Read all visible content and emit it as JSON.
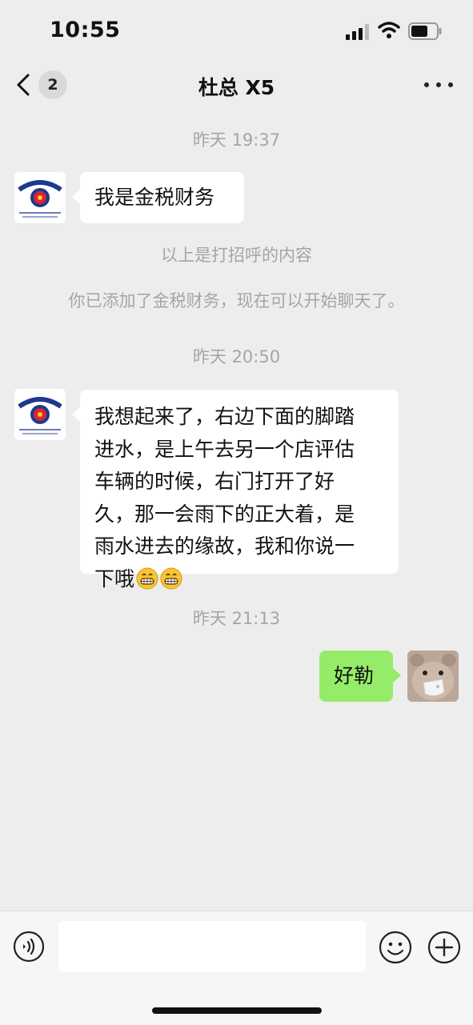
{
  "status": {
    "time": "10:55"
  },
  "header": {
    "back_badge": "2",
    "title": "杜总 X5"
  },
  "messages": [
    {
      "kind": "timestamp",
      "text": "昨天 19:37"
    },
    {
      "kind": "incoming",
      "sender": "金税财务",
      "text": "我是金税财务"
    },
    {
      "kind": "system",
      "text": "以上是打招呼的内容"
    },
    {
      "kind": "system",
      "text": "你已添加了金税财务，现在可以开始聊天了。"
    },
    {
      "kind": "timestamp",
      "text": "昨天 20:50"
    },
    {
      "kind": "incoming",
      "sender": "金税财务",
      "lines": [
        "我想起来了，右边下面的脚踏",
        "进水，是上午去另一个店评估",
        "车辆的时候，右门打开了好",
        "久，那一会雨下的正大着，是",
        "雨水进去的缘故，我和你说一",
        "下哦"
      ],
      "trailing_emoji": "grinning-face-emoji x2"
    },
    {
      "kind": "timestamp",
      "text": "昨天 21:13"
    },
    {
      "kind": "outgoing",
      "text": "好勒"
    }
  ],
  "avatar_logo_text": "金税财务管理有限公司",
  "input": {
    "value": "",
    "placeholder": ""
  },
  "colors": {
    "background": "#ededed",
    "outgoing_bubble": "#95ec69",
    "incoming_bubble": "#ffffff",
    "meta_text": "#a5a5a5"
  },
  "icons": [
    "back-chevron-icon",
    "more-dots-icon",
    "voice-icon",
    "emoji-icon",
    "plus-icon",
    "signal-icon",
    "wifi-icon",
    "battery-icon"
  ]
}
